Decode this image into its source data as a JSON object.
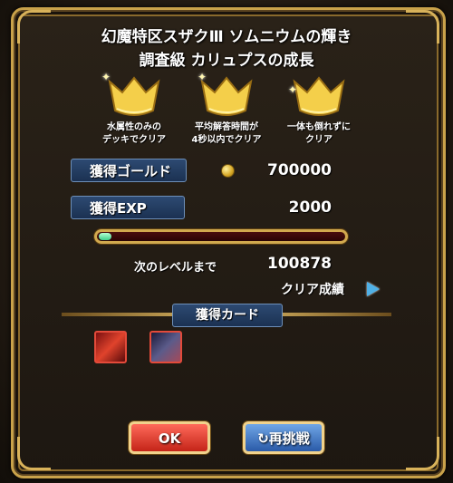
{
  "header": {
    "stage_title": "幻魔特区スザクⅢ ソムニウムの輝き",
    "quest_title": "調査級 カリュプスの成長"
  },
  "crowns": [
    {
      "label": "水属性のみの\nデッキでクリア",
      "achieved": true
    },
    {
      "label": "平均解答時間が\n4秒以内でクリア",
      "achieved": true
    },
    {
      "label": "一体も倒れずに\nクリア",
      "achieved": true
    }
  ],
  "rewards": {
    "gold_label": "獲得ゴールド",
    "gold_value": "700000",
    "exp_label": "獲得EXP",
    "exp_value": "2000",
    "exp_progress_fraction": 0.04,
    "next_level_label": "次のレベルまで",
    "next_level_value": "100878"
  },
  "clear_record_link": "クリア成績",
  "cards_section": {
    "title": "獲得カード",
    "cards": [
      {
        "name": "red-card"
      },
      {
        "name": "dark-card"
      }
    ]
  },
  "buttons": {
    "ok": "OK",
    "retry": "再挑戦"
  },
  "colors": {
    "gold_frame": "#c9a24a",
    "plate_blue": "#2d4a72",
    "ok_red": "#c42418",
    "retry_blue": "#2a5aa8",
    "exp_green": "#3fcf8a"
  }
}
